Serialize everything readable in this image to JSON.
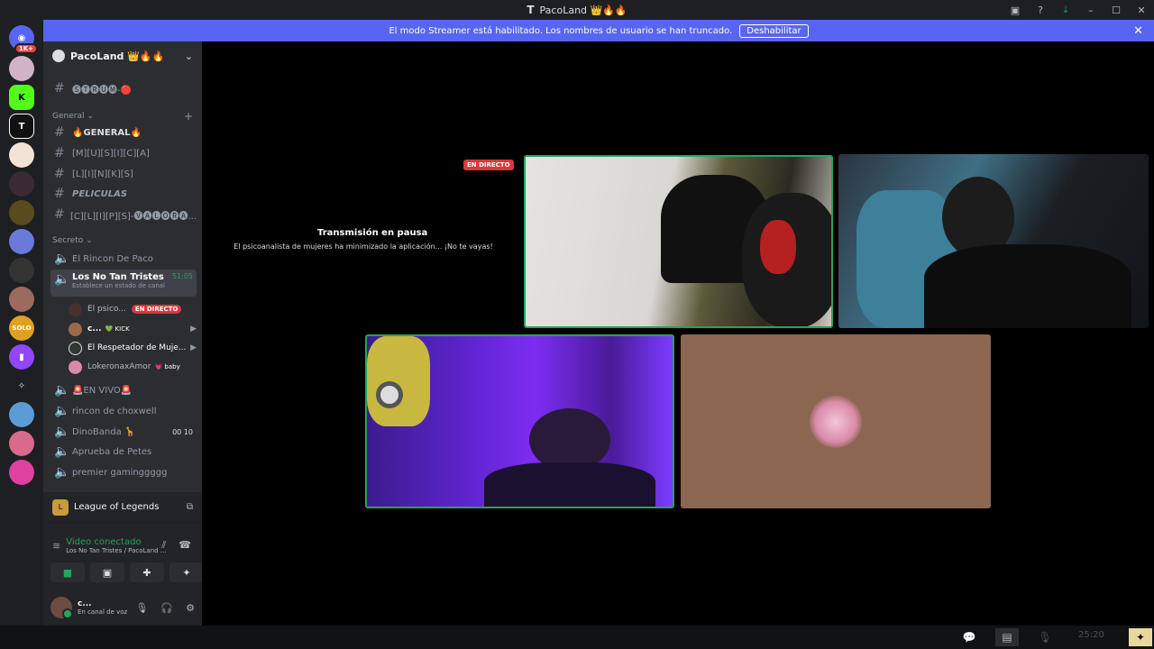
{
  "window": {
    "title": "PacoLand 👑🔥🔥",
    "logo": "T"
  },
  "banner": {
    "text": "El modo Streamer está habilitado. Los nombres de usuario se han truncado.",
    "button": "Deshabilitar"
  },
  "servers": [
    {
      "icon": "discord-home-icon",
      "badge": "1K+",
      "color": "#5865f2"
    },
    {
      "icon": "server-anime-icon",
      "color": "#d1b3c7"
    },
    {
      "icon": "kick-icon",
      "label": "K",
      "color": "#53fc18"
    },
    {
      "icon": "pacoland-icon",
      "label": "T",
      "color": "#1e1f22"
    },
    {
      "icon": "server-cat-icon",
      "color": "#f2e3d5"
    },
    {
      "icon": "server-girl-icon",
      "color": "#3b2a35"
    },
    {
      "icon": "server-crown-icon",
      "color": "#e0c050"
    },
    {
      "icon": "server-blue-icon",
      "color": "#6a7ad8"
    },
    {
      "icon": "server-skull-icon",
      "color": "#333333"
    },
    {
      "icon": "server-face-icon",
      "color": "#9a6b5e"
    },
    {
      "icon": "solo-icon",
      "label": "SOLO",
      "color": "#e0a020"
    },
    {
      "icon": "twitch-icon",
      "color": "#9146ff"
    },
    {
      "icon": "valorant-icon",
      "color": "#1e1f22"
    },
    {
      "icon": "server-landscape-icon",
      "color": "#5c9bd6"
    },
    {
      "icon": "server-pink-icon",
      "color": "#d86a8a"
    },
    {
      "icon": "server-magenta-icon",
      "color": "#e040a0"
    }
  ],
  "guild": {
    "name": "PacoLand 👑🔥🔥",
    "top_channel": "🅢🅣🅡🅤🅜-🔴",
    "categories": {
      "general": "General",
      "secreto": "Secreto"
    },
    "general_channels": [
      "🔥GENERAL🔥",
      "[M][U][S][I][C][A]",
      "[L][I][N][K][S]",
      "PELICULAS",
      "[C][L][I][P][S]-🅥🅐🅛🅞🅡🅐..."
    ],
    "voice_channels_top": [
      "El Rincon De Paco"
    ],
    "active_voice": {
      "name": "Los No Tan Tristes",
      "timer": "51:05",
      "status": "Establece un estado de canal"
    },
    "voice_users": [
      {
        "name": "El psico...",
        "live": "EN DIRECTO",
        "color": "#4a2f2f"
      },
      {
        "name": "c...",
        "tag": "💚 KICK",
        "color": "#9a6b4a",
        "cam": true
      },
      {
        "name": "El Respetador de Muje...",
        "color": "#2f3a2f",
        "cam": true
      },
      {
        "name": "LokeronaxAmor",
        "tag": "💗 baby",
        "color": "#d98aa8"
      }
    ],
    "voice_channels_bottom": [
      {
        "name": "🚨EN VIVO🚨"
      },
      {
        "name": "rincon de choxwell"
      },
      {
        "name": "DinoBanda 🦒",
        "counts": "00  10"
      },
      {
        "name": "Aprueba de Petes"
      },
      {
        "name": "premier gaminggggg"
      }
    ]
  },
  "panel": {
    "activity": "League of Legends",
    "connection": "Video conectado",
    "connection_detail": "Los No Tan Tristes / PacoLand ...",
    "user_name": "c...",
    "user_status": "En canal de voz"
  },
  "stage": {
    "live_badge": "EN DIRECTO",
    "pause_title": "Transmisión en pausa",
    "pause_subtitle": "El psicoanalista de mujeres ha minimizado la aplicación... ¡No te vayas!"
  },
  "taskbar": {
    "clock": "25:20"
  },
  "colors": {
    "blurple": "#5865f2",
    "green": "#23a55a",
    "red": "#da373c"
  }
}
